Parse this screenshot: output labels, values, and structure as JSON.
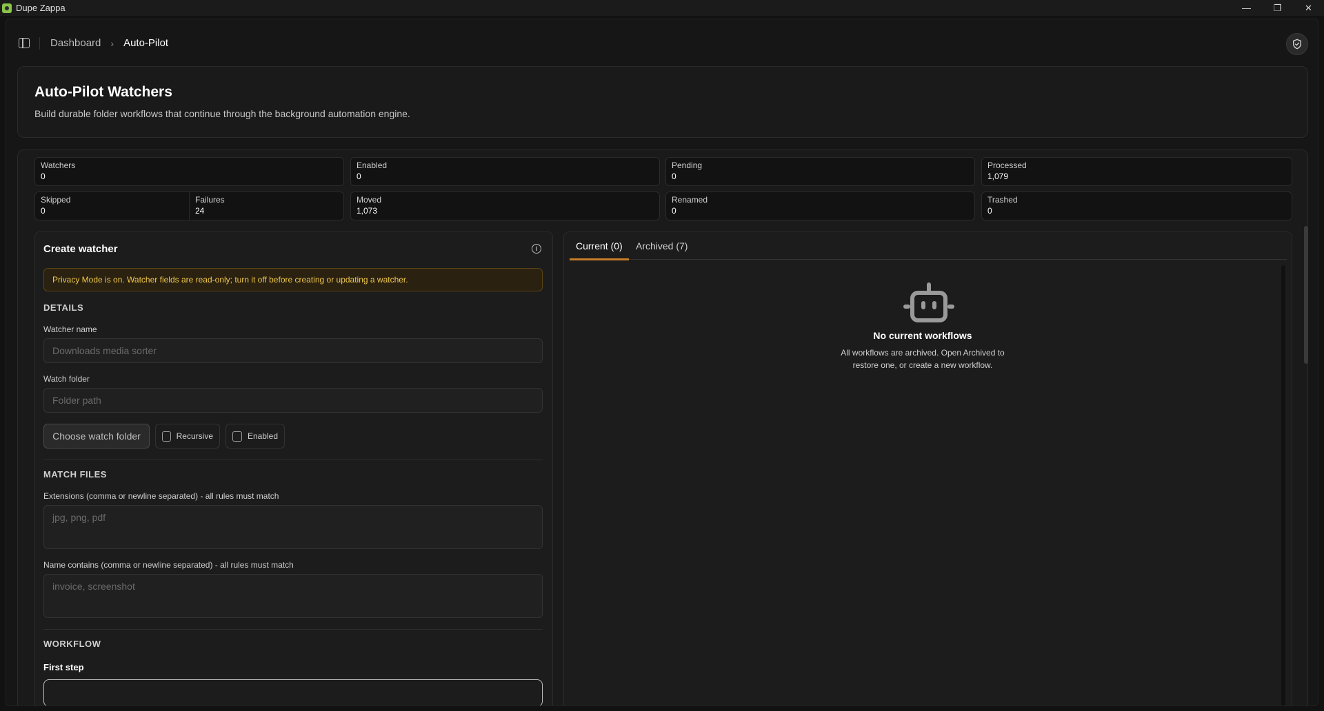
{
  "window": {
    "title": "Dupe Zappa",
    "controls": {
      "minimize": "—",
      "restore": "❐",
      "close": "✕"
    }
  },
  "breadcrumb": {
    "parent": "Dashboard",
    "current": "Auto-Pilot",
    "separator": "›"
  },
  "header": {
    "title": "Auto-Pilot Watchers",
    "subtitle": "Build durable folder workflows that continue through the background automation engine."
  },
  "stats": {
    "watchers": {
      "label": "Watchers",
      "value": "0"
    },
    "enabled": {
      "label": "Enabled",
      "value": "0"
    },
    "pending": {
      "label": "Pending",
      "value": "0"
    },
    "processed": {
      "label": "Processed",
      "value": "1,079"
    },
    "skipped": {
      "label": "Skipped",
      "value": "0"
    },
    "failures": {
      "label": "Failures",
      "value": "24"
    },
    "moved": {
      "label": "Moved",
      "value": "1,073"
    },
    "renamed": {
      "label": "Renamed",
      "value": "0"
    },
    "trashed": {
      "label": "Trashed",
      "value": "0"
    }
  },
  "create_watcher": {
    "title": "Create watcher",
    "privacy_banner": "Privacy Mode is on. Watcher fields are read-only; turn it off before creating or updating a watcher.",
    "details_heading": "DETAILS",
    "watcher_name_label": "Watcher name",
    "watcher_name_placeholder": "Downloads media sorter",
    "watch_folder_label": "Watch folder",
    "watch_folder_placeholder": "Folder path",
    "choose_button": "Choose watch folder",
    "recursive_label": "Recursive",
    "enabled_label": "Enabled",
    "match_heading": "MATCH FILES",
    "extensions_label": "Extensions (comma or newline separated) - all rules must match",
    "extensions_placeholder": "jpg, png, pdf",
    "name_contains_label": "Name contains (comma or newline separated) - all rules must match",
    "name_contains_placeholder": "invoice, screenshot",
    "workflow_heading": "WORKFLOW",
    "first_step_label": "First step"
  },
  "workflows": {
    "tabs": [
      {
        "label": "Current (0)"
      },
      {
        "label": "Archived (7)"
      }
    ],
    "empty_title": "No current workflows",
    "empty_text": "All workflows are archived. Open Archived to restore one, or create a new workflow."
  },
  "icons": {
    "sidebar_toggle": "sidebar-icon",
    "shield": "shield-check-icon",
    "info": "info-icon",
    "robot": "robot-icon"
  },
  "colors": {
    "accent": "#c77d2a",
    "warning_text": "#f2c94c",
    "warning_bg": "#2a2110"
  }
}
